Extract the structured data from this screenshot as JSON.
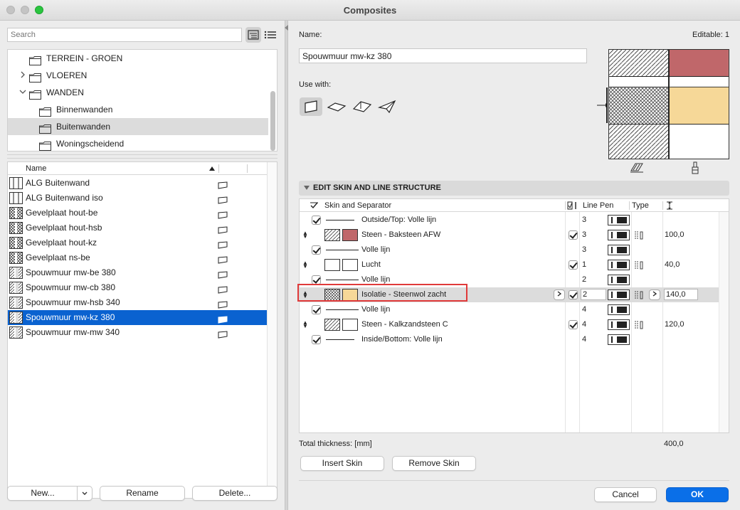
{
  "window": {
    "title": "Composites"
  },
  "search": {
    "placeholder": "Search"
  },
  "tree": {
    "items": [
      {
        "label": "TERREIN - GROEN",
        "level": 0,
        "expander": ""
      },
      {
        "label": "VLOEREN",
        "level": 0,
        "expander": ">"
      },
      {
        "label": "WANDEN",
        "level": 0,
        "expander": "v"
      },
      {
        "label": "Binnenwanden",
        "level": 1,
        "expander": ""
      },
      {
        "label": "Buitenwanden",
        "level": 1,
        "expander": "",
        "selected": true
      },
      {
        "label": "Woningscheidend",
        "level": 1,
        "expander": ""
      }
    ]
  },
  "list": {
    "column_name": "Name",
    "rows": [
      {
        "label": "ALG Buitenwand",
        "pattern": "plain"
      },
      {
        "label": "ALG Buitenwand iso",
        "pattern": "plain"
      },
      {
        "label": "Gevelplaat hout-be",
        "pattern": "cross"
      },
      {
        "label": "Gevelplaat hout-hsb",
        "pattern": "cross"
      },
      {
        "label": "Gevelplaat hout-kz",
        "pattern": "cross"
      },
      {
        "label": "Gevelplaat ns-be",
        "pattern": "cross"
      },
      {
        "label": "Spouwmuur mw-be 380",
        "pattern": "hatch"
      },
      {
        "label": "Spouwmuur mw-cb 380",
        "pattern": "hatch"
      },
      {
        "label": "Spouwmuur mw-hsb 340",
        "pattern": "hatch"
      },
      {
        "label": "Spouwmuur mw-kz 380",
        "pattern": "hatch",
        "selected": true
      },
      {
        "label": "Spouwmuur mw-mw 340",
        "pattern": "hatch"
      }
    ]
  },
  "buttons": {
    "new": "New...",
    "rename": "Rename",
    "delete": "Delete...",
    "insert_skin": "Insert Skin",
    "remove_skin": "Remove Skin",
    "cancel": "Cancel",
    "ok": "OK"
  },
  "details": {
    "name_label": "Name:",
    "editable": "Editable: 1",
    "name_value": "Spouwmuur mw-kz 380",
    "use_with_label": "Use with:"
  },
  "section": {
    "title": "EDIT SKIN AND LINE STRUCTURE"
  },
  "skin_table": {
    "headers": {
      "check": "",
      "skin": "Skin and Separator",
      "lp": "Line Pen",
      "type": "Type"
    },
    "rows": [
      {
        "kind": "line",
        "label": "Outside/Top: Volle lijn",
        "pen": "3",
        "checked": true
      },
      {
        "kind": "skin",
        "label": "Steen - Baksteen AFW",
        "pen": "3",
        "thickness": "100,0",
        "fill": "hatch",
        "color": "#c0676a",
        "core": true
      },
      {
        "kind": "line",
        "label": "Volle lijn",
        "pen": "3",
        "checked": true
      },
      {
        "kind": "skin",
        "label": "Lucht",
        "pen": "1",
        "thickness": "40,0",
        "fill": "empty",
        "color": "#ffffff",
        "core": true
      },
      {
        "kind": "line",
        "label": "Volle lijn",
        "pen": "2",
        "checked": true
      },
      {
        "kind": "skin",
        "label": "Isolatie - Steenwol zacht",
        "pen": "2",
        "thickness": "140,0",
        "fill": "dots",
        "color": "#f6d898",
        "core": true,
        "selected": true
      },
      {
        "kind": "line",
        "label": "Volle lijn",
        "pen": "4",
        "checked": true
      },
      {
        "kind": "skin",
        "label": "Steen - Kalkzandsteen C",
        "pen": "4",
        "thickness": "120,0",
        "fill": "hatch",
        "color": "#ffffff",
        "core": true
      },
      {
        "kind": "line",
        "label": "Inside/Bottom: Volle lijn",
        "pen": "4",
        "checked": true
      }
    ]
  },
  "totals": {
    "label": "Total thickness: [mm]",
    "value": "400,0"
  },
  "colors": {
    "accent": "#0a62d0",
    "highlight": "#e03a3a",
    "brick": "#c0676a",
    "insulation": "#f6d898"
  }
}
